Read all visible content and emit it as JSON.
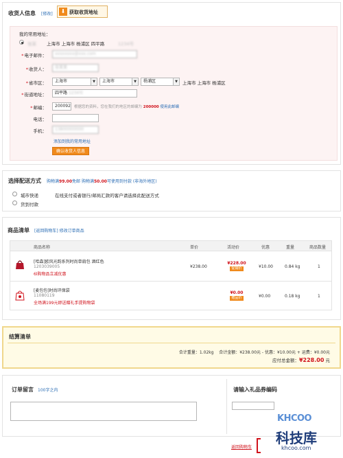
{
  "colors": {
    "accent": "#f08a1c",
    "link": "#2c6eb5",
    "price": "#d0121b",
    "highlight_bg": "#fffbe6",
    "highlight_border": "#f0d78c"
  },
  "consignee": {
    "title": "收货人信息",
    "modify_link": "[修改]",
    "fetch_button": "获取收货地址",
    "common_address_label": "我的常用地址：",
    "common_address_name": "张某",
    "common_address_text": "上海市 上海市 杨浦区 四平路",
    "common_address_blur": "1234号",
    "email_label": "电子邮件：",
    "email_value": "xxxxxxxx@xxx.com",
    "recipient_label": "收货人：",
    "recipient_value": "张某某",
    "region_label": "省市区：",
    "province": "上海市",
    "city": "上海市",
    "district": "杨浦区",
    "region_text": "上海市 上海市 杨浦区",
    "street_label": "街道地址：",
    "street_value": "四平路",
    "street_blur": "1234号",
    "zip_label": "邮编：",
    "zip_value": "200092",
    "zip_hint": "根据您的资料，您在我们的地区的邮编为",
    "zip_hint_code": "200000",
    "zip_hint_link": "使用此邮编",
    "phone_label": "电话：",
    "phone_value": "",
    "mobile_label": "手机：",
    "mobile_value": "13800000000",
    "add_address_link": "添加到我的常用地址",
    "confirm_button": "确认收货人信息"
  },
  "shipping": {
    "title": "选择配送方式",
    "note_prefix": "购物满",
    "note_amount1": "99.00",
    "note_mid": "免邮",
    "note_prefix2": "购物满",
    "note_amount2": "50.00",
    "note_mid2": "可使用到付款",
    "note_link": "(非海外地区)",
    "options": [
      {
        "label": "城市快递",
        "desc": "在线支付或者银行/邮局汇款的客户请选择此配送方式"
      },
      {
        "label": "货到付款",
        "desc": ""
      }
    ]
  },
  "cart": {
    "title": "商品清单",
    "back_link": "[返回购物车]",
    "modify_link": "修改订单商品",
    "headers": [
      "商品名称",
      "单价",
      "活动价",
      "优惠",
      "重量",
      "商品数量"
    ],
    "items": [
      {
        "name": "[哈森]欧风光韵系列时尚单肩包 酒红色",
        "code": "1203039005",
        "promo": "6l购物品立减优惠",
        "price": "¥238.00",
        "sale_price": "¥228.00",
        "sale_tag": "促销价",
        "discount": "¥10.00",
        "weight": "0.84 kg",
        "qty": "1"
      },
      {
        "name": "[麦包包]时尚环保袋",
        "code": "11080119",
        "promo": "全场满199元即送赠礼手提购物袋",
        "price": "",
        "sale_price": "¥0.00",
        "sale_tag": "赠品价",
        "discount": "¥0.00",
        "weight": "0.18 kg",
        "qty": "1"
      }
    ]
  },
  "settlement": {
    "title": "结算清单",
    "line": "合计重量：1.02kg    合计金额：¥238.00元 - 优惠：¥10.00元 + 运费：¥0.00元",
    "total_label": "应付总金额：",
    "total_value": "¥228.00",
    "total_unit": "元"
  },
  "remark": {
    "title": "订单留言",
    "limit": "100字之内",
    "value": ""
  },
  "coupon": {
    "title": "请输入礼品券编码",
    "value": ""
  },
  "footer": {
    "back_link": "返回购物车",
    "watermark_logo": "KHCOO",
    "watermark_cn": "科技库",
    "watermark_url": "khcoo.com"
  }
}
